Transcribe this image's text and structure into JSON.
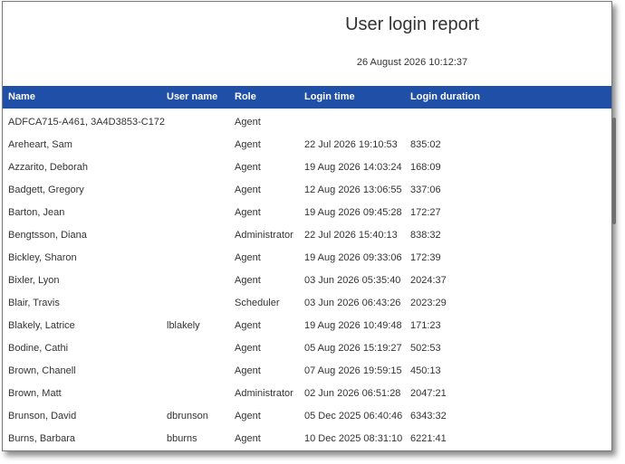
{
  "report": {
    "title": "User login report",
    "timestamp": "26 August 2026 10:12:37"
  },
  "table": {
    "columns": [
      "Name",
      "User name",
      "Role",
      "Login time",
      "Login duration"
    ],
    "rows": [
      {
        "name": "ADFCA715-A461, 3A4D3853-C172",
        "username": "",
        "role": "Agent",
        "login_time": "",
        "duration": ""
      },
      {
        "name": "Areheart, Sam",
        "username": "",
        "role": "Agent",
        "login_time": "22 Jul 2026 19:10:53",
        "duration": "835:02"
      },
      {
        "name": "Azzarito, Deborah",
        "username": "",
        "role": "Agent",
        "login_time": "19 Aug 2026 14:03:24",
        "duration": "168:09"
      },
      {
        "name": "Badgett, Gregory",
        "username": "",
        "role": "Agent",
        "login_time": "12 Aug 2026 13:06:55",
        "duration": "337:06"
      },
      {
        "name": "Barton, Jean",
        "username": "",
        "role": "Agent",
        "login_time": "19 Aug 2026 09:45:28",
        "duration": "172:27"
      },
      {
        "name": "Bengtsson, Diana",
        "username": "",
        "role": "Administrator",
        "login_time": "22 Jul 2026 15:40:13",
        "duration": "838:32"
      },
      {
        "name": "Bickley, Sharon",
        "username": "",
        "role": "Agent",
        "login_time": "19 Aug 2026 09:33:06",
        "duration": "172:39"
      },
      {
        "name": "Bixler, Lyon",
        "username": "",
        "role": "Agent",
        "login_time": "03 Jun 2026 05:35:40",
        "duration": "2024:37"
      },
      {
        "name": "Blair, Travis",
        "username": "",
        "role": "Scheduler",
        "login_time": "03 Jun 2026 06:43:26",
        "duration": "2023:29"
      },
      {
        "name": "Blakely, Latrice",
        "username": "lblakely",
        "role": "Agent",
        "login_time": "19 Aug 2026 10:49:48",
        "duration": "171:23"
      },
      {
        "name": "Bodine, Cathi",
        "username": "",
        "role": "Agent",
        "login_time": "05 Aug 2026 15:19:27",
        "duration": "502:53"
      },
      {
        "name": "Brown, Chanell",
        "username": "",
        "role": "Agent",
        "login_time": "07 Aug 2026 19:59:15",
        "duration": "450:13"
      },
      {
        "name": "Brown, Matt",
        "username": "",
        "role": "Administrator",
        "login_time": "02 Jun 2026 06:51:28",
        "duration": "2047:21"
      },
      {
        "name": "Brunson, David",
        "username": "dbrunson",
        "role": "Agent",
        "login_time": "05 Dec 2025 06:40:46",
        "duration": "6343:32"
      },
      {
        "name": "Burns, Barbara",
        "username": "bburns",
        "role": "Agent",
        "login_time": "10 Dec 2025 08:31:10",
        "duration": "6221:41"
      }
    ]
  }
}
